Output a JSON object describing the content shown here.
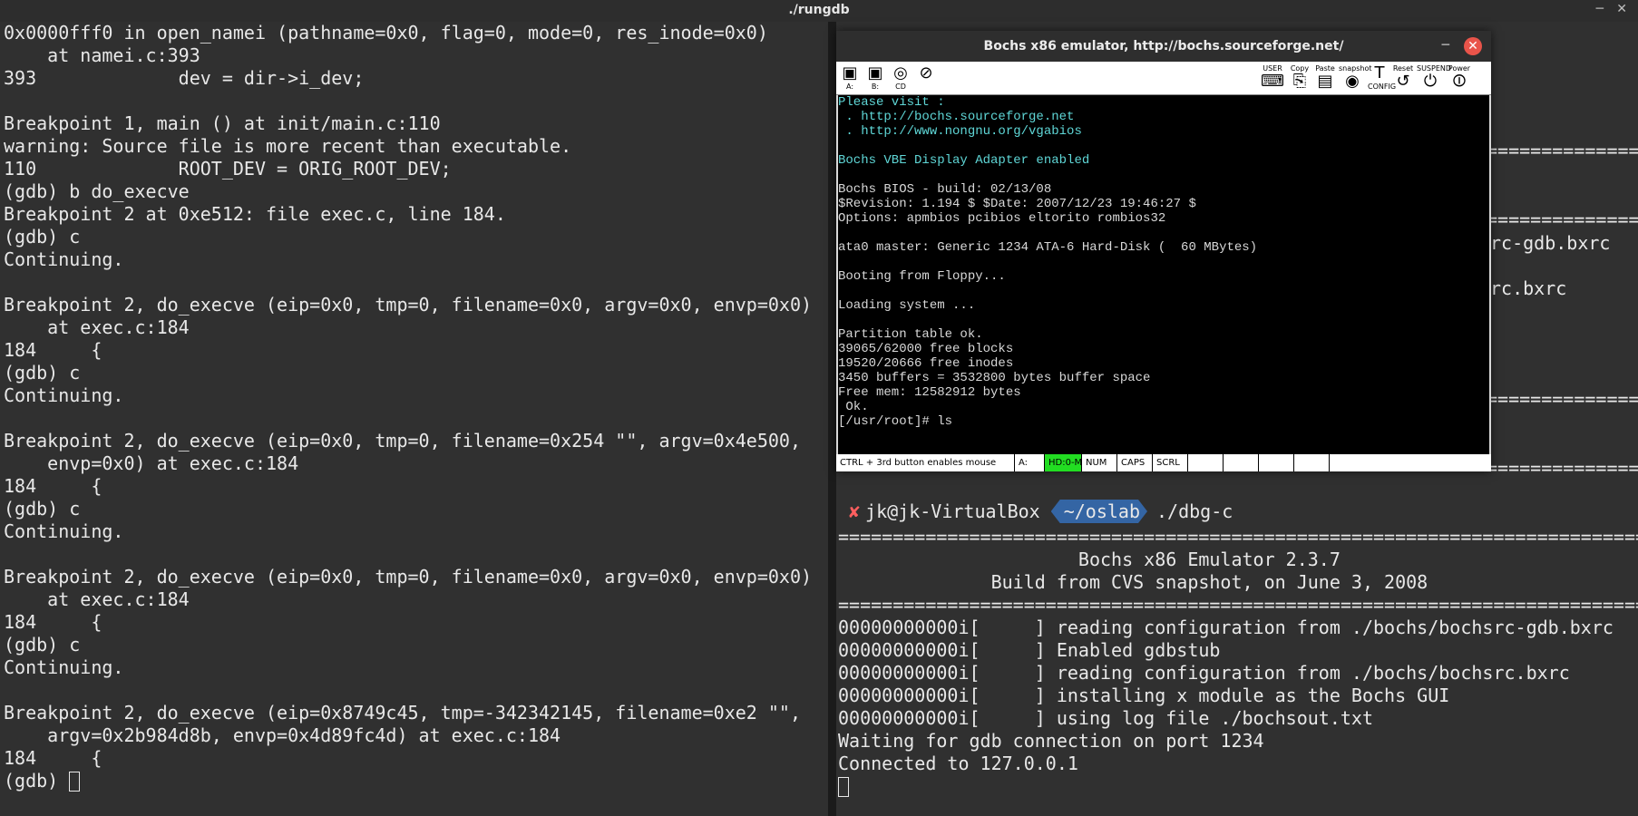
{
  "window": {
    "title": "./rungdb"
  },
  "left_terminal": {
    "lines": [
      "0x0000fff0 in open_namei (pathname=0x0, flag=0, mode=0, res_inode=0x0)",
      "    at namei.c:393",
      "393             dev = dir->i_dev;",
      "",
      "Breakpoint 1, main () at init/main.c:110",
      "warning: Source file is more recent than executable.",
      "110             ROOT_DEV = ORIG_ROOT_DEV;",
      "(gdb) b do_execve",
      "Breakpoint 2 at 0xe512: file exec.c, line 184.",
      "(gdb) c",
      "Continuing.",
      "",
      "Breakpoint 2, do_execve (eip=0x0, tmp=0, filename=0x0, argv=0x0, envp=0x0)",
      "    at exec.c:184",
      "184     {",
      "(gdb) c",
      "Continuing.",
      "",
      "Breakpoint 2, do_execve (eip=0x0, tmp=0, filename=0x254 \"\", argv=0x4e500,",
      "    envp=0x0) at exec.c:184",
      "184     {",
      "(gdb) c",
      "Continuing.",
      "",
      "Breakpoint 2, do_execve (eip=0x0, tmp=0, filename=0x0, argv=0x0, envp=0x0)",
      "    at exec.c:184",
      "184     {",
      "(gdb) c",
      "Continuing.",
      "",
      "Breakpoint 2, do_execve (eip=0x8749c45, tmp=-342342145, filename=0xe2 \"\",",
      "    argv=0x2b984d8b, envp=0x4d89fc4d) at exec.c:184",
      "184     {"
    ],
    "prompt": "(gdb) "
  },
  "right_terminal": {
    "bg_fragments": [
      "================",
      "================",
      "rc-gdb.bxrc",
      "rc.bxrc",
      "================",
      "================"
    ],
    "prompt": {
      "status": "✘",
      "user": "jk@jk-VirtualBox",
      "path": "~/oslab",
      "command": "./dbg-c"
    },
    "lines": [
      "===============================================================================",
      "                      Bochs x86 Emulator 2.3.7",
      "              Build from CVS snapshot, on June 3, 2008",
      "===============================================================================",
      "00000000000i[     ] reading configuration from ./bochs/bochsrc-gdb.bxrc",
      "00000000000i[     ] Enabled gdbstub",
      "00000000000i[     ] reading configuration from ./bochs/bochsrc.bxrc",
      "00000000000i[     ] installing x module as the Bochs GUI",
      "00000000000i[     ] using log file ./bochsout.txt",
      "Waiting for gdb connection on port 1234",
      "Connected to 127.0.0.1"
    ]
  },
  "bochs": {
    "title": "Bochs x86 emulator, http://bochs.sourceforge.net/",
    "toolbar_left": [
      {
        "label": "A:",
        "icon": "floppy-a-icon"
      },
      {
        "label": "B:",
        "icon": "floppy-b-icon"
      },
      {
        "label": "CD",
        "icon": "cdrom-icon"
      },
      {
        "label": "",
        "icon": "mouse-icon"
      }
    ],
    "toolbar_right": [
      {
        "label": "USER",
        "icon": "keyboard-icon"
      },
      {
        "label": "Copy",
        "icon": "copy-icon"
      },
      {
        "label": "Paste",
        "icon": "paste-icon"
      },
      {
        "label": "snapshot",
        "icon": "camera-icon"
      },
      {
        "label": "CONFIG",
        "icon": "config-icon"
      },
      {
        "label": "Reset",
        "icon": "reset-icon"
      },
      {
        "label": "SUSPEND",
        "icon": "suspend-icon"
      },
      {
        "label": "Power",
        "icon": "power-icon"
      }
    ],
    "screen_lines": [
      {
        "text": "Please visit :",
        "color": "cyan"
      },
      {
        "text": " . http://bochs.sourceforge.net",
        "color": "cyan"
      },
      {
        "text": " . http://www.nongnu.org/vgabios",
        "color": "cyan"
      },
      {
        "text": "",
        "color": "white"
      },
      {
        "text": "Bochs VBE Display Adapter enabled",
        "color": "cyan"
      },
      {
        "text": "",
        "color": "white"
      },
      {
        "text": "Bochs BIOS - build: 02/13/08",
        "color": "white"
      },
      {
        "text": "$Revision: 1.194 $ $Date: 2007/12/23 19:46:27 $",
        "color": "white"
      },
      {
        "text": "Options: apmbios pcibios eltorito rombios32",
        "color": "white"
      },
      {
        "text": "",
        "color": "white"
      },
      {
        "text": "ata0 master: Generic 1234 ATA-6 Hard-Disk (  60 MBytes)",
        "color": "white"
      },
      {
        "text": "",
        "color": "white"
      },
      {
        "text": "Booting from Floppy...",
        "color": "white"
      },
      {
        "text": "",
        "color": "white"
      },
      {
        "text": "Loading system ...",
        "color": "white"
      },
      {
        "text": "",
        "color": "white"
      },
      {
        "text": "Partition table ok.",
        "color": "white"
      },
      {
        "text": "39065/62000 free blocks",
        "color": "white"
      },
      {
        "text": "19520/20666 free inodes",
        "color": "white"
      },
      {
        "text": "3450 buffers = 3532800 bytes buffer space",
        "color": "white"
      },
      {
        "text": "Free mem: 12582912 bytes",
        "color": "white"
      },
      {
        "text": " Ok.",
        "color": "white"
      },
      {
        "text": "[/usr/root]# ls",
        "color": "white"
      }
    ],
    "status": {
      "hint": "CTRL + 3rd button enables mouse",
      "a": "A:",
      "hd": "HD:0-M",
      "num": "NUM",
      "caps": "CAPS",
      "scrl": "SCRL"
    },
    "colors": {
      "cyan": "#5fd7d7",
      "hd_led": "#22dd22",
      "close": "#e9544a"
    }
  }
}
